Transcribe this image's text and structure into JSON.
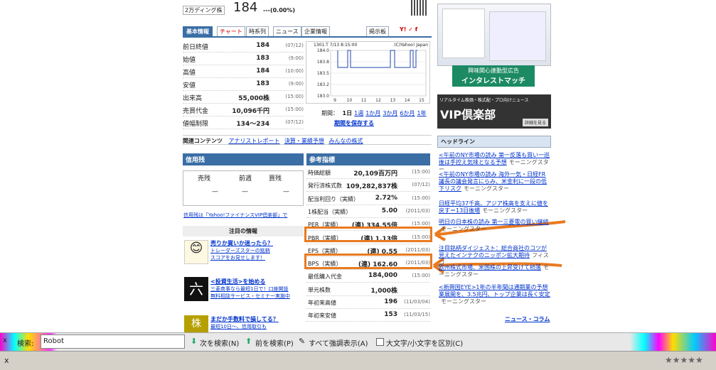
{
  "top": {
    "market_label": "2万ディング株",
    "price_big": "184",
    "change": "---(0.00%)"
  },
  "tabs": [
    "基本情報",
    "チャート",
    "時系列",
    "ニュース",
    "企業情報"
  ],
  "bbs_label": "掲示板",
  "stock_rows": [
    {
      "label": "前日終値",
      "value": "184",
      "date": "(07/12)"
    },
    {
      "label": "始値",
      "value": "183",
      "date": "(9:00)"
    },
    {
      "label": "高値",
      "value": "184",
      "date": "(10:00)"
    },
    {
      "label": "安値",
      "value": "183",
      "date": "(9:00)"
    },
    {
      "label": "出来高",
      "value": "55,000株",
      "date": "(15:00)"
    },
    {
      "label": "売買代金",
      "value": "10,096千円",
      "date": "(15:00)"
    },
    {
      "label": "値幅制限",
      "value": "134～234",
      "date": "(07/12)"
    }
  ],
  "chart": {
    "header_left": "1301.T 7/13 8:15:00",
    "header_right": "(C)Yahoo! Japan",
    "y_ticks": [
      "184.0",
      "183.8",
      "183.5",
      "183.2",
      "183.0"
    ],
    "x_ticks": [
      "9",
      "10",
      "11",
      "12",
      "13",
      "14",
      "15"
    ],
    "period_label": "期間：",
    "periods": [
      "1日",
      "1週",
      "1か月",
      "3か月",
      "6か月",
      "1年"
    ],
    "save_period": "期間を保存する"
  },
  "related": {
    "label": "関連コンテンツ",
    "links": [
      "アナリストレポート",
      "決算・業績予想",
      "みんなの株式"
    ]
  },
  "shinyo": {
    "title": "信用残",
    "cols": [
      "売残",
      "前週",
      "買残"
    ],
    "vals": [
      "—",
      "—",
      "—"
    ],
    "footer": "信用残は「Yahoo!ファイナンスVIP倶楽部」で"
  },
  "ref": {
    "title": "参考指標",
    "rows": [
      {
        "label": "時価総額",
        "value": "20,109百万円",
        "date": "(15:00)"
      },
      {
        "label": "発行済株式数",
        "value": "109,282,837株",
        "date": "(07/12)"
      },
      {
        "label": "配当利回り（実績）",
        "value": "2.72%",
        "date": "(15:00)"
      },
      {
        "label": "1株配当（実績）",
        "value": "5.00",
        "date": "(2011/03)"
      },
      {
        "label": "PER（実績）",
        "value": "(連) 334.55倍",
        "date": "(15:00)"
      },
      {
        "label": "PBR（実績）",
        "value": "(連) 1.13倍",
        "date": "(15:00)"
      },
      {
        "label": "EPS（実績）",
        "value": "(連) 0.55",
        "date": "(2011/03)"
      },
      {
        "label": "BPS（実績）",
        "value": "(連) 162.60",
        "date": "(2011/03)"
      },
      {
        "label": "最低購入代金",
        "value": "184,000",
        "date": "(15:00)"
      },
      {
        "label": "単元株数",
        "value": "1,000株",
        "date": ""
      },
      {
        "label": "年初来高値",
        "value": "196",
        "date": "(11/03/04)"
      },
      {
        "label": "年初来安値",
        "value": "153",
        "date": "(11/03/15)"
      }
    ]
  },
  "notice": {
    "title": "注目の情報",
    "items": [
      {
        "head": "売りか買いか迷ったら？",
        "sub": "トレーダーズスターの銘柄",
        "sub2": "スコアをお見せします！"
      },
      {
        "head": "<投資生活>を始める",
        "sub": "三菱商事なら最短1日で！口座開設",
        "sub2": "無料相談サービス・セミナー実施中"
      },
      {
        "head": "まだか手数料で損してる？",
        "sub": "最短10日〜、信用取引も",
        "sub2": ""
      }
    ]
  },
  "ads": {
    "ad1_line1": "興味関心連動型広告",
    "ad1_line2": "インタレストマッチ",
    "ad2_line1": "リアルタイム株価・株式配・プロ向けニュース",
    "ad2_big": "VIP倶楽部",
    "ad2_btn": "詳細を見る"
  },
  "headlines": {
    "title": "ヘッドライン",
    "items": [
      {
        "text": "<午前のNY市場の読み 第一反落も買い一巡後は手控え気味となる予想",
        "src": "モーニングスター"
      },
      {
        "text": "<午前のNY市場の読み 海外一気・日経FR議長の議会発言にらみ、米金利に一段の低下リスク",
        "src": "モーニングスター"
      },
      {
        "text": "日経平均37千高、アジア株高を支えに値を戻す＝13日後場",
        "src": "モーニングスター"
      },
      {
        "text": "明日の日本株の読み 第一三菱電の買い継続",
        "src": "モーニングスター"
      },
      {
        "text": "注目銘柄ダイジェスト：総合商社のコツが見えたインテクのニッポン拡大期待",
        "src": "フィスコ"
      },
      {
        "text": "欧州株式市場、米国株の上昇受けて続落",
        "src": "モーニングスター"
      },
      {
        "text": "<新興国EYE>1年の半年間は通期業の予想業展開を、3.5兆円、トップ企業は長く安定",
        "src": "モーニングスター"
      }
    ],
    "more": "ニュース・コラム"
  },
  "findbar": {
    "close": "x",
    "label": "検索:",
    "value": "Robot",
    "next": "次を検索(N)",
    "prev": "前を検索(P)",
    "highlight": "すべて強調表示(A)",
    "match_case": "大文字/小文字を区別(C)"
  },
  "status": {
    "stars": "★★★★★"
  },
  "colors": {
    "accent": "#3a6ea5",
    "annotation": "#e97a1f"
  }
}
